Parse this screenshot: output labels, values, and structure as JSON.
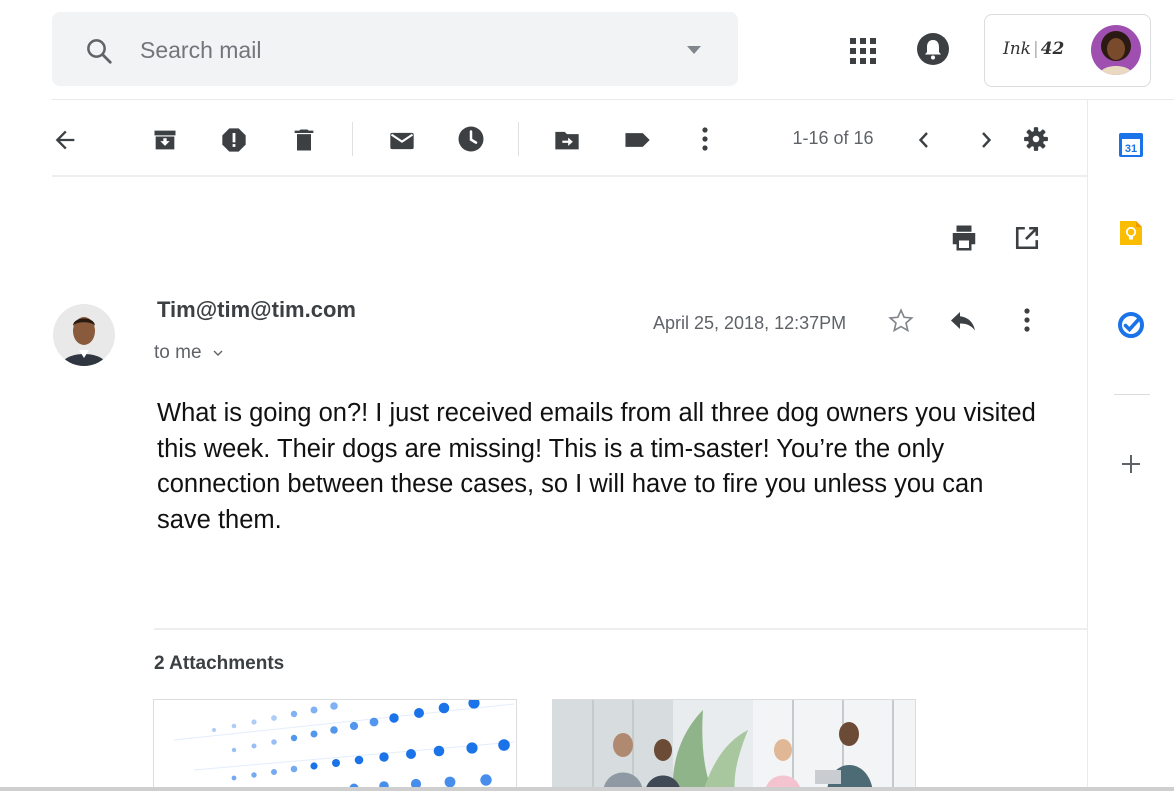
{
  "search": {
    "placeholder": "Search mail"
  },
  "header": {
    "brand_script": "Ink",
    "brand_number": "42"
  },
  "toolbar": {
    "pager": "1-16 of 16"
  },
  "message": {
    "sender": "Tim@tim@tim.com",
    "recipient": "to me",
    "date": "April 25, 2018, 12:37PM",
    "body": "What is going on?! I just received emails from all three dog owners you visited this week. Their dogs are missing! This is a tim-saster! You’re the only connection between these cases, so I will have to fire you unless you can save them."
  },
  "attachments": {
    "title": "2 Attachments"
  },
  "side_panel": {
    "calendar_day": "31"
  },
  "icons": {
    "toolbar": [
      "back-arrow-icon",
      "archive-icon",
      "report-spam-icon",
      "delete-icon",
      "mark-unread-icon",
      "snooze-icon",
      "move-to-icon",
      "label-icon",
      "more-vert-icon",
      "chevron-left-icon",
      "chevron-right-icon",
      "settings-gear-icon"
    ],
    "side_panel": [
      "calendar-icon",
      "keep-icon",
      "tasks-icon",
      "add-icon"
    ]
  },
  "colors": {
    "accent_blue": "#1a73e8",
    "keep_yellow": "#fbbc04",
    "icon_grey": "#5f6368",
    "search_bg": "#f1f3f4"
  }
}
